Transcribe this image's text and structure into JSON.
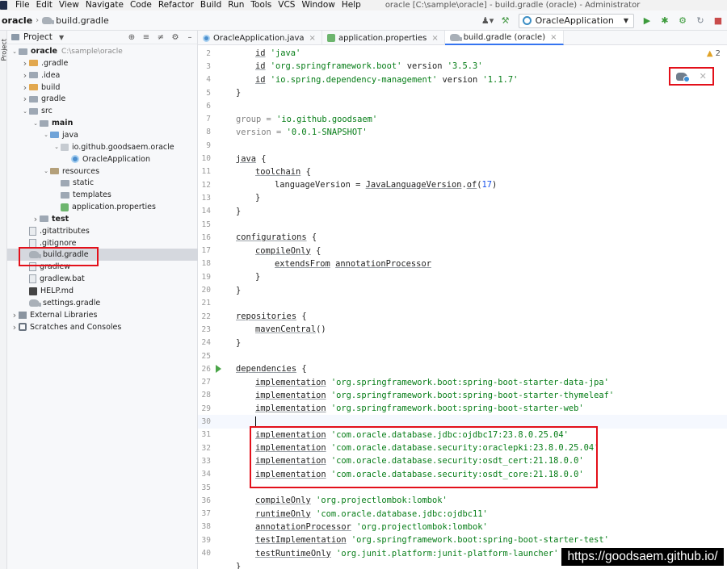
{
  "menubar": {
    "items": [
      "File",
      "Edit",
      "View",
      "Navigate",
      "Code",
      "Refactor",
      "Build",
      "Run",
      "Tools",
      "VCS",
      "Window",
      "Help"
    ],
    "window_title": "oracle [C:\\sample\\oracle] - build.gradle (oracle) - Administrator"
  },
  "navbar": {
    "project": "oracle",
    "file": "build.gradle",
    "run_config": "OracleApplication"
  },
  "left_strip": {
    "label": "Project"
  },
  "project_panel": {
    "title": "Project",
    "tree": [
      {
        "label": "oracle",
        "path": "C:\\sample\\oracle",
        "bold": true,
        "depth": 0,
        "arrow": "open",
        "icon": "folder"
      },
      {
        "label": ".gradle",
        "depth": 1,
        "arrow": "closed",
        "icon": "folder-orange"
      },
      {
        "label": ".idea",
        "depth": 1,
        "arrow": "closed",
        "icon": "folder"
      },
      {
        "label": "build",
        "depth": 1,
        "arrow": "closed",
        "icon": "folder-orange"
      },
      {
        "label": "gradle",
        "depth": 1,
        "arrow": "closed",
        "icon": "folder"
      },
      {
        "label": "src",
        "depth": 1,
        "arrow": "open",
        "icon": "folder"
      },
      {
        "label": "main",
        "depth": 2,
        "arrow": "open",
        "icon": "folder",
        "bold": true
      },
      {
        "label": "java",
        "depth": 3,
        "arrow": "open",
        "icon": "folder-blue"
      },
      {
        "label": "io.github.goodsaem.oracle",
        "depth": 4,
        "arrow": "open",
        "icon": "package"
      },
      {
        "label": "OracleApplication",
        "depth": 5,
        "arrow": "none",
        "icon": "class"
      },
      {
        "label": "resources",
        "depth": 3,
        "arrow": "open",
        "icon": "folder-res"
      },
      {
        "label": "static",
        "depth": 4,
        "arrow": "none",
        "icon": "folder"
      },
      {
        "label": "templates",
        "depth": 4,
        "arrow": "none",
        "icon": "folder"
      },
      {
        "label": "application.properties",
        "depth": 4,
        "arrow": "none",
        "icon": "props"
      },
      {
        "label": "test",
        "depth": 2,
        "arrow": "closed",
        "icon": "folder",
        "bold": true
      },
      {
        "label": ".gitattributes",
        "depth": 1,
        "arrow": "none",
        "icon": "file"
      },
      {
        "label": ".gitignore",
        "depth": 1,
        "arrow": "none",
        "icon": "file"
      },
      {
        "label": "build.gradle",
        "depth": 1,
        "arrow": "none",
        "icon": "gradle",
        "selected": true
      },
      {
        "label": "gradlew",
        "depth": 1,
        "arrow": "none",
        "icon": "file"
      },
      {
        "label": "gradlew.bat",
        "depth": 1,
        "arrow": "none",
        "icon": "file"
      },
      {
        "label": "HELP.md",
        "depth": 1,
        "arrow": "none",
        "icon": "md"
      },
      {
        "label": "settings.gradle",
        "depth": 1,
        "arrow": "none",
        "icon": "gradle"
      },
      {
        "label": "External Libraries",
        "depth": 0,
        "arrow": "closed",
        "icon": "libs"
      },
      {
        "label": "Scratches and Consoles",
        "depth": 0,
        "arrow": "closed",
        "icon": "scratch"
      }
    ]
  },
  "tabs": [
    {
      "label": "OracleApplication.java",
      "icon": "class",
      "active": false
    },
    {
      "label": "application.properties",
      "icon": "props",
      "active": false
    },
    {
      "label": "build.gradle (oracle)",
      "icon": "gradle",
      "active": true
    }
  ],
  "editor": {
    "warnings": "2",
    "lines": [
      {
        "n": "2",
        "indent": 1,
        "tokens": [
          [
            "kw",
            "id"
          ],
          [
            "p",
            " "
          ],
          [
            "str",
            "'java'"
          ]
        ]
      },
      {
        "n": "3",
        "indent": 1,
        "tokens": [
          [
            "kw",
            "id"
          ],
          [
            "p",
            " "
          ],
          [
            "str",
            "'org.springframework.boot'"
          ],
          [
            "p",
            " version "
          ],
          [
            "str",
            "'3.5.3'"
          ]
        ]
      },
      {
        "n": "4",
        "indent": 1,
        "tokens": [
          [
            "kw",
            "id"
          ],
          [
            "p",
            " "
          ],
          [
            "str",
            "'io.spring.dependency-management'"
          ],
          [
            "p",
            " version "
          ],
          [
            "str",
            "'1.1.7'"
          ]
        ]
      },
      {
        "n": "5",
        "indent": 0,
        "tokens": [
          [
            "p",
            "}"
          ]
        ]
      },
      {
        "n": "6",
        "indent": 0,
        "tokens": []
      },
      {
        "n": "7",
        "indent": 0,
        "tokens": [
          [
            "gray",
            "group"
          ],
          [
            "gray",
            " = "
          ],
          [
            "str",
            "'io.github.goodsaem'"
          ]
        ]
      },
      {
        "n": "8",
        "indent": 0,
        "tokens": [
          [
            "gray",
            "version"
          ],
          [
            "gray",
            " = "
          ],
          [
            "str",
            "'0.0.1-SNAPSHOT'"
          ]
        ]
      },
      {
        "n": "9",
        "indent": 0,
        "tokens": []
      },
      {
        "n": "10",
        "indent": 0,
        "tokens": [
          [
            "kw",
            "java"
          ],
          [
            "p",
            " {"
          ]
        ]
      },
      {
        "n": "11",
        "indent": 1,
        "tokens": [
          [
            "kw",
            "toolchain"
          ],
          [
            "p",
            " {"
          ]
        ]
      },
      {
        "n": "12",
        "indent": 2,
        "tokens": [
          [
            "p",
            "languageVersion = "
          ],
          [
            "kw",
            "JavaLanguageVersion"
          ],
          [
            "p",
            "."
          ],
          [
            "kw",
            "of"
          ],
          [
            "p",
            "("
          ],
          [
            "num",
            "17"
          ],
          [
            "p",
            ")"
          ]
        ]
      },
      {
        "n": "13",
        "indent": 1,
        "tokens": [
          [
            "p",
            "}"
          ]
        ]
      },
      {
        "n": "14",
        "indent": 0,
        "tokens": [
          [
            "p",
            "}"
          ]
        ]
      },
      {
        "n": "15",
        "indent": 0,
        "tokens": []
      },
      {
        "n": "16",
        "indent": 0,
        "tokens": [
          [
            "kw",
            "configurations"
          ],
          [
            "p",
            " {"
          ]
        ]
      },
      {
        "n": "17",
        "indent": 1,
        "tokens": [
          [
            "kw",
            "compileOnly"
          ],
          [
            "p",
            " {"
          ]
        ]
      },
      {
        "n": "18",
        "indent": 2,
        "tokens": [
          [
            "kw",
            "extendsFrom"
          ],
          [
            "p",
            " "
          ],
          [
            "kw",
            "annotationProcessor"
          ]
        ]
      },
      {
        "n": "19",
        "indent": 1,
        "tokens": [
          [
            "p",
            "}"
          ]
        ]
      },
      {
        "n": "20",
        "indent": 0,
        "tokens": [
          [
            "p",
            "}"
          ]
        ]
      },
      {
        "n": "21",
        "indent": 0,
        "tokens": []
      },
      {
        "n": "22",
        "indent": 0,
        "tokens": [
          [
            "kw",
            "repositories"
          ],
          [
            "p",
            " {"
          ]
        ]
      },
      {
        "n": "23",
        "indent": 1,
        "tokens": [
          [
            "kw",
            "mavenCentral"
          ],
          [
            "p",
            "()"
          ]
        ]
      },
      {
        "n": "24",
        "indent": 0,
        "tokens": [
          [
            "p",
            "}"
          ]
        ]
      },
      {
        "n": "25",
        "indent": 0,
        "tokens": []
      },
      {
        "n": "26",
        "indent": 0,
        "tokens": [
          [
            "kw",
            "dependencies"
          ],
          [
            "p",
            " {"
          ]
        ],
        "run": true
      },
      {
        "n": "27",
        "indent": 1,
        "tokens": [
          [
            "kw",
            "implementation"
          ],
          [
            "p",
            " "
          ],
          [
            "str",
            "'org.springframework.boot:spring-boot-starter-data-jpa'"
          ]
        ]
      },
      {
        "n": "28",
        "indent": 1,
        "tokens": [
          [
            "kw",
            "implementation"
          ],
          [
            "p",
            " "
          ],
          [
            "str",
            "'org.springframework.boot:spring-boot-starter-thymeleaf'"
          ]
        ]
      },
      {
        "n": "29",
        "indent": 1,
        "tokens": [
          [
            "kw",
            "implementation"
          ],
          [
            "p",
            " "
          ],
          [
            "str",
            "'org.springframework.boot:spring-boot-starter-web'"
          ]
        ]
      },
      {
        "n": "30",
        "indent": 1,
        "tokens": [],
        "current": true
      },
      {
        "n": "31",
        "indent": 1,
        "tokens": [
          [
            "kw",
            "implementation"
          ],
          [
            "p",
            " "
          ],
          [
            "str",
            "'com.oracle.database.jdbc:ojdbc17:23.8.0.25.04'"
          ]
        ]
      },
      {
        "n": "32",
        "indent": 1,
        "tokens": [
          [
            "kw",
            "implementation"
          ],
          [
            "p",
            " "
          ],
          [
            "str",
            "'com.oracle.database.security:oraclepki:23.8.0.25.04'"
          ]
        ]
      },
      {
        "n": "33",
        "indent": 1,
        "tokens": [
          [
            "kw",
            "implementation"
          ],
          [
            "p",
            " "
          ],
          [
            "str",
            "'com.oracle.database.security:osdt_cert:21.18.0.0'"
          ]
        ]
      },
      {
        "n": "34",
        "indent": 1,
        "tokens": [
          [
            "kw",
            "implementation"
          ],
          [
            "p",
            " "
          ],
          [
            "str",
            "'com.oracle.database.security:osdt_core:21.18.0.0'"
          ]
        ]
      },
      {
        "n": "35",
        "indent": 0,
        "tokens": []
      },
      {
        "n": "36",
        "indent": 1,
        "tokens": [
          [
            "kw",
            "compileOnly"
          ],
          [
            "p",
            " "
          ],
          [
            "str",
            "'org.projectlombok:lombok'"
          ]
        ]
      },
      {
        "n": "37",
        "indent": 1,
        "tokens": [
          [
            "kw",
            "runtimeOnly"
          ],
          [
            "p",
            " "
          ],
          [
            "str",
            "'com.oracle.database.jdbc:ojdbc11'"
          ]
        ]
      },
      {
        "n": "38",
        "indent": 1,
        "tokens": [
          [
            "kw",
            "annotationProcessor"
          ],
          [
            "p",
            " "
          ],
          [
            "str",
            "'org.projectlombok:lombok'"
          ]
        ]
      },
      {
        "n": "39",
        "indent": 1,
        "tokens": [
          [
            "kw",
            "testImplementation"
          ],
          [
            "p",
            " "
          ],
          [
            "str",
            "'org.springframework.boot:spring-boot-starter-test'"
          ]
        ]
      },
      {
        "n": "40",
        "indent": 1,
        "tokens": [
          [
            "kw",
            "testRuntimeOnly"
          ],
          [
            "p",
            " "
          ],
          [
            "str",
            "'org.junit.platform:junit-platform-launcher'"
          ]
        ]
      },
      {
        "n": "",
        "indent": 0,
        "tokens": [
          [
            "p",
            "}"
          ]
        ]
      }
    ]
  },
  "watermark": "https://goodsaem.github.io/"
}
